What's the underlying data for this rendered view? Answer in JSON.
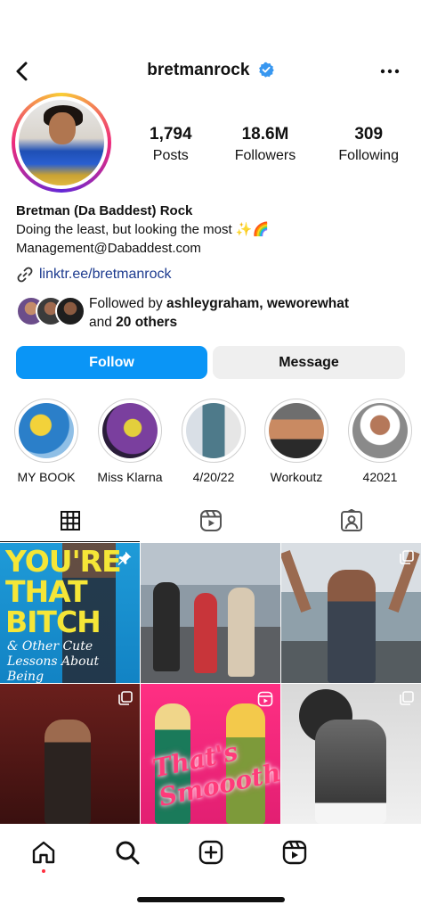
{
  "header": {
    "username": "bretmanrock",
    "back_icon": "chevron-left-icon",
    "verified_icon": "verified-badge-icon",
    "more_icon": "more-horizontal-icon"
  },
  "profile": {
    "avatar_icon": "profile-avatar",
    "stats": [
      {
        "value": "1,794",
        "label": "Posts"
      },
      {
        "value": "18.6M",
        "label": "Followers"
      },
      {
        "value": "309",
        "label": "Following"
      }
    ],
    "name": "Bretman (Da Baddest) Rock",
    "bio_line1": "Doing the least, but looking the most ✨🌈",
    "bio_line2": "Management@Dabaddest.com",
    "link": "linktr.ee/bretmanrock",
    "followed_by_prefix": "Followed by ",
    "followed_by_users": "ashleygraham, weworewhat",
    "followed_by_and": "and ",
    "followed_by_others": "20 others"
  },
  "actions": {
    "follow_label": "Follow",
    "message_label": "Message",
    "follow_color": "#0a95f6"
  },
  "highlights": [
    {
      "label": "MY BOOK"
    },
    {
      "label": "Miss Klarna"
    },
    {
      "label": "4/20/22"
    },
    {
      "label": "Workoutz"
    },
    {
      "label": "42021"
    }
  ],
  "tabs": [
    {
      "icon": "grid-icon",
      "active": true
    },
    {
      "icon": "reels-icon",
      "active": false
    },
    {
      "icon": "tagged-icon",
      "active": false
    }
  ],
  "grid": {
    "post1_title": "YOU'RE THAT BITCH",
    "post1_subtitle": "& Other Cute Lessons About Being Unapologetically Yourself",
    "post5_text": "That's Smoooth"
  },
  "bottom_nav": [
    {
      "icon": "home-icon"
    },
    {
      "icon": "search-icon"
    },
    {
      "icon": "create-post-icon"
    },
    {
      "icon": "reels-icon"
    }
  ],
  "colors": {
    "accent": "#0a95f6",
    "link": "#1d3b8f",
    "notification_dot": "#ff3040"
  }
}
